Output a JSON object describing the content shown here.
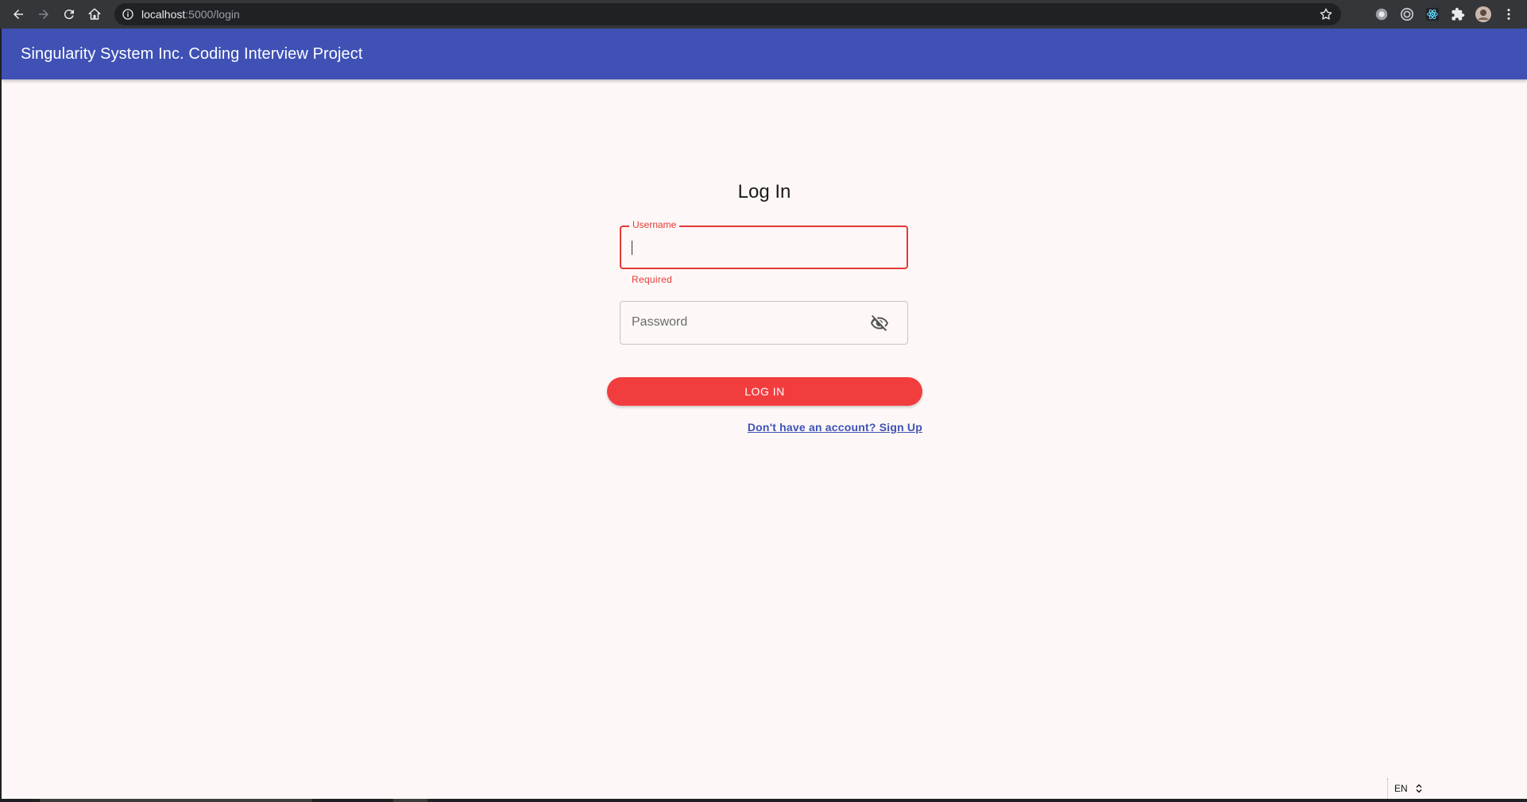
{
  "browser": {
    "url_host": "localhost",
    "url_path": ":5000/login",
    "icons": [
      "back-icon",
      "forward-icon",
      "reload-icon",
      "home-icon",
      "site-info-icon",
      "bookmark-star-icon",
      "extension-icon",
      "profile-avatar",
      "menu-kebab-icon"
    ]
  },
  "appbar": {
    "title": "Singularity System Inc. Coding Interview Project",
    "color": "#3f51b5"
  },
  "login": {
    "title": "Log In",
    "username": {
      "label": "Username",
      "value": "",
      "helper": "Required",
      "error_color": "#e53935"
    },
    "password": {
      "placeholder": "Password",
      "value": "",
      "visibility_icon": "visibility-off-icon"
    },
    "submit_label": "LOG IN",
    "submit_color": "#f23d3f",
    "signup_link": "Don't have an account? Sign Up"
  },
  "language": {
    "selected": "EN"
  }
}
